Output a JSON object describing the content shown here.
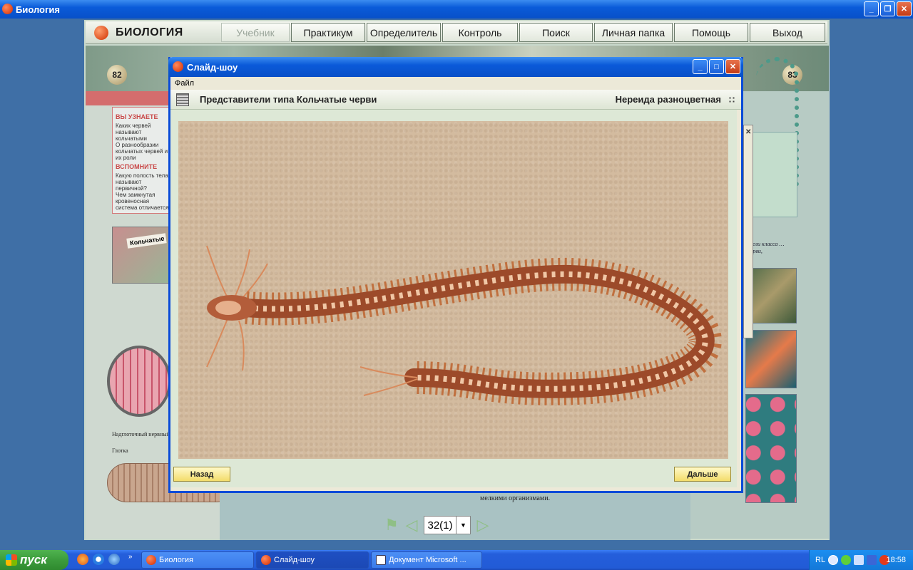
{
  "main_window": {
    "title": "Биология",
    "controls": [
      "_",
      "❐",
      "✕"
    ]
  },
  "app_menu": {
    "brand": "БИОЛОГИЯ",
    "items": [
      {
        "label": "Учебник",
        "disabled": true
      },
      {
        "label": "Практикум",
        "disabled": false
      },
      {
        "label": "Определитель",
        "disabled": false
      },
      {
        "label": "Контроль",
        "disabled": false
      },
      {
        "label": "Поиск",
        "disabled": false
      },
      {
        "label": "Личная папка",
        "disabled": false
      },
      {
        "label": "Помощь",
        "disabled": false
      },
      {
        "label": "Выход",
        "disabled": false
      }
    ]
  },
  "textbook": {
    "page_left": "82",
    "page_right": "83",
    "learn_heading": "ВЫ УЗНАЕТЕ",
    "learn_items": [
      "Каких червей называют кольчатыми",
      "О разнообразии кольчатых червей и их роли"
    ],
    "recall_heading": "ВСПОМНИТЕ",
    "recall_items": [
      "Какую полость тела называют первичной?",
      "Чем замкнутая кровеносная система отличается"
    ],
    "card_label": "Кольчатые",
    "diagram_label_1": "Надглоточный нервный узел",
    "diagram_label_2": "Глотка",
    "right_text": "…ели класса …черви,",
    "footer_text": "мелкими организмами."
  },
  "pager": {
    "value": "32(1)"
  },
  "slideshow": {
    "title": "Слайд-шоу",
    "menu_file": "Файл",
    "section_title": "Представители типа Кольчатые черви",
    "slide_title": "Нереида разноцветная",
    "back_label": "Назад",
    "next_label": "Дальше"
  },
  "taskbar": {
    "start_label": "пуск",
    "tasks": [
      {
        "label": "Биология",
        "active": false
      },
      {
        "label": "Слайд-шоу",
        "active": true
      },
      {
        "label": "Документ Microsoft ...",
        "active": false
      }
    ],
    "language": "RL",
    "clock": "18:58"
  }
}
